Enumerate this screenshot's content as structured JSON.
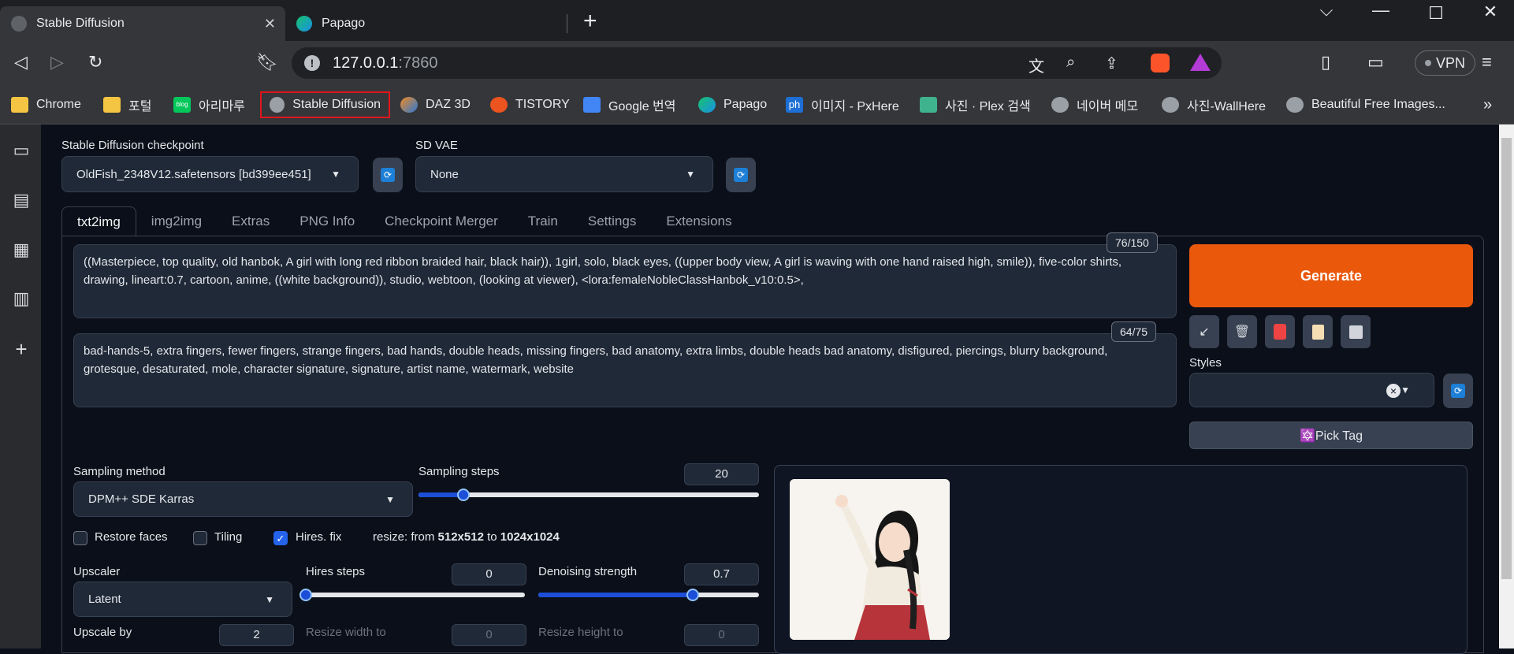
{
  "browser": {
    "tabs": [
      {
        "title": "Stable Diffusion",
        "active": true
      },
      {
        "title": "Papago",
        "active": false
      }
    ],
    "new_tab_label": "+",
    "address": {
      "host": "127.0.0.1",
      "port": ":7860"
    },
    "vpn_label": "VPN",
    "bookmarks": [
      {
        "label": "Chrome",
        "icon": "folder-icon"
      },
      {
        "label": "포털",
        "icon": "folder-icon"
      },
      {
        "label": "아리마루",
        "icon": "blog-icon"
      },
      {
        "label": "Stable Diffusion",
        "icon": "globe-icon"
      },
      {
        "label": "DAZ 3D",
        "icon": "daz-icon"
      },
      {
        "label": "TISTORY",
        "icon": "tistory-icon"
      },
      {
        "label": "Google 번역",
        "icon": "google-translate-icon"
      },
      {
        "label": "Papago",
        "icon": "papago-icon"
      },
      {
        "label": "이미지 - PxHere",
        "icon": "pxhere-icon"
      },
      {
        "label": "사진 · Plex 검색",
        "icon": "plex-icon"
      },
      {
        "label": "네이버 메모",
        "icon": "globe-icon"
      },
      {
        "label": "사진-WallHere",
        "icon": "globe-icon"
      },
      {
        "label": "Beautiful Free Images...",
        "icon": "globe-icon"
      }
    ],
    "bookmarks_overflow": "»",
    "blog_badge": "blog",
    "ph_badge": "ph"
  },
  "webui": {
    "checkpoint_label": "Stable Diffusion checkpoint",
    "checkpoint_value": "OldFish_2348V12.safetensors [bd399ee451]",
    "vae_label": "SD VAE",
    "vae_value": "None",
    "tabs": [
      "txt2img",
      "img2img",
      "Extras",
      "PNG Info",
      "Checkpoint Merger",
      "Train",
      "Settings",
      "Extensions"
    ],
    "prompt": "((Masterpiece, top quality, old hanbok, A girl with long red ribbon braided hair, black hair)), 1girl, solo, black eyes, ((upper body view, A girl is waving with one hand raised high, smile)), five-color shirts, drawing, lineart:0.7, cartoon, anime, ((white background)), studio, webtoon, (looking at viewer), <lora:femaleNobleClassHanbok_v10:0.5>,",
    "prompt_counter": "76/150",
    "negative_prompt": "bad-hands-5, extra fingers, fewer fingers, strange fingers, bad hands, double heads, missing fingers, bad anatomy, extra limbs, double heads bad anatomy, disfigured, piercings, blurry background, grotesque, desaturated, mole, character signature, signature, artist name, watermark, website",
    "negative_counter": "64/75",
    "generate_label": "Generate",
    "styles_label": "Styles",
    "styles_clear": "×",
    "pick_tag_label": "🔯Pick Tag",
    "sampling_method_label": "Sampling method",
    "sampling_method_value": "DPM++ SDE Karras",
    "sampling_steps_label": "Sampling steps",
    "sampling_steps_value": "20",
    "restore_faces_label": "Restore faces",
    "tiling_label": "Tiling",
    "hires_fix_label": "Hires. fix",
    "resize_prefix": "resize: from ",
    "resize_from": "512x512",
    "resize_mid": " to ",
    "resize_to": "1024x1024",
    "upscaler_label": "Upscaler",
    "upscaler_value": "Latent",
    "hires_steps_label": "Hires steps",
    "hires_steps_value": "0",
    "denoising_label": "Denoising strength",
    "denoising_value": "0.7",
    "upscale_by_label": "Upscale by",
    "upscale_by_value": "2",
    "resize_width_label": "Resize width to",
    "resize_width_value": "0",
    "resize_height_label": "Resize height to",
    "resize_height_value": "0"
  },
  "levels": {
    "sampling_steps": 0.133,
    "hires_steps": 0.0,
    "denoising_strength": 0.7
  },
  "colors": {
    "generate": "#ea580c",
    "accent": "#1d4ed8",
    "highlight_box": "#e0161b"
  }
}
